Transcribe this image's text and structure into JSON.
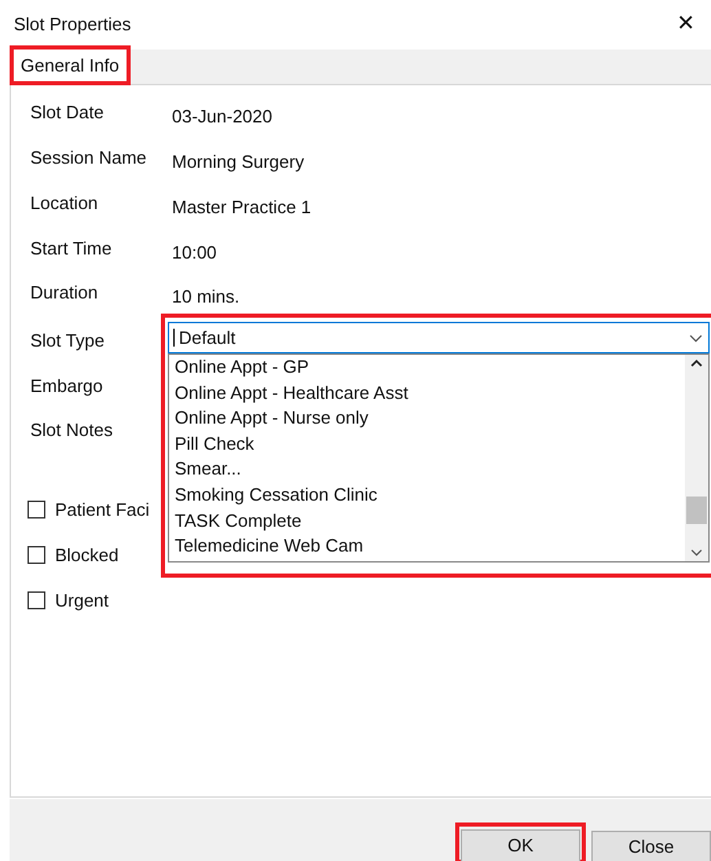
{
  "window": {
    "title": "Slot Properties",
    "close": "✕"
  },
  "tabs": [
    {
      "label": "General Info",
      "selected": true,
      "highlighted": true
    }
  ],
  "fields": [
    {
      "label": "Slot Date",
      "value": "03-Jun-2020"
    },
    {
      "label": "Session Name",
      "value": "Morning  Surgery"
    },
    {
      "label": "Location",
      "value": "Master Practice 1"
    },
    {
      "label": "Start Time",
      "value": "10:00"
    },
    {
      "label": "Duration",
      "value": "10 mins."
    }
  ],
  "slot_type": {
    "label": "Slot Type",
    "value": "Default",
    "expanded": true,
    "highlighted": true,
    "options": [
      "Online Appt - GP",
      "Online Appt - Healthcare Asst",
      "Online Appt - Nurse only",
      "Pill Check",
      "Smear...",
      "Smoking Cessation Clinic",
      "TASK Complete",
      "Telemedicine Web Cam"
    ]
  },
  "other_labels": [
    "Embargo",
    "Slot Notes"
  ],
  "checkboxes": [
    {
      "label": "Patient Faci",
      "checked": false
    },
    {
      "label": "Blocked",
      "checked": false
    },
    {
      "label": "Urgent",
      "checked": false
    }
  ],
  "buttons": [
    {
      "label": "OK",
      "highlighted": true
    },
    {
      "label": "Close",
      "highlighted": false
    }
  ]
}
